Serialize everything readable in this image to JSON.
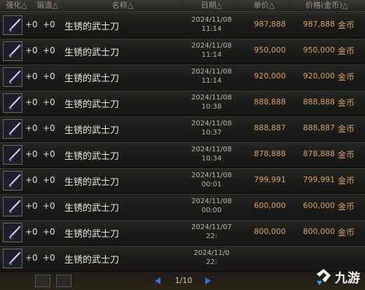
{
  "header": {
    "enhance": "强化△",
    "amplify": "锻造△",
    "name": "名称△",
    "date": "日期△",
    "unit_price": "单价△",
    "total_price": "价格(金币)△"
  },
  "rows": [
    {
      "enhance": "+0",
      "amplify": "+0",
      "name": "生锈的武士刀",
      "date": "2024/11/08",
      "time": "11:14",
      "unit": "987,888",
      "total": "987,888",
      "currency": "金币"
    },
    {
      "enhance": "+0",
      "amplify": "+0",
      "name": "生锈的武士刀",
      "date": "2024/11/08",
      "time": "11:14",
      "unit": "950,000",
      "total": "950,000",
      "currency": "金币"
    },
    {
      "enhance": "+0",
      "amplify": "+0",
      "name": "生锈的武士刀",
      "date": "2024/11/08",
      "time": "11:14",
      "unit": "920,000",
      "total": "920,000",
      "currency": "金币"
    },
    {
      "enhance": "+0",
      "amplify": "+0",
      "name": "生锈的武士刀",
      "date": "2024/11/08",
      "time": "10:38",
      "unit": "888,888",
      "total": "888,888",
      "currency": "金币"
    },
    {
      "enhance": "+0",
      "amplify": "+0",
      "name": "生锈的武士刀",
      "date": "2024/11/08",
      "time": "10:37",
      "unit": "888,887",
      "total": "888,887",
      "currency": "金币"
    },
    {
      "enhance": "+0",
      "amplify": "+0",
      "name": "生锈的武士刀",
      "date": "2024/11/08",
      "time": "10:34",
      "unit": "878,888",
      "total": "878,888",
      "currency": "金币"
    },
    {
      "enhance": "+0",
      "amplify": "+0",
      "name": "生锈的武士刀",
      "date": "2024/11/08",
      "time": "00:01",
      "unit": "799,991",
      "total": "799,991",
      "currency": "金币"
    },
    {
      "enhance": "+0",
      "amplify": "+0",
      "name": "生锈的武士刀",
      "date": "2024/11/08",
      "time": "00:00",
      "unit": "600,000",
      "total": "600,000",
      "currency": "金币"
    },
    {
      "enhance": "+0",
      "amplify": "+0",
      "name": "生锈的武士刀",
      "date": "2024/11/07",
      "time": "22:",
      "unit": "800,000",
      "total": "800,000",
      "currency": "金币"
    },
    {
      "enhance": "+0",
      "amplify": "+0",
      "name": "生锈的武士刀",
      "date": "2024/11/0",
      "time": "22:",
      "unit": "",
      "total": "",
      "currency": ""
    }
  ],
  "footer": {
    "page": "1/10",
    "btn1": "",
    "btn2": ""
  },
  "watermark": "九游",
  "icon": "katana-icon"
}
